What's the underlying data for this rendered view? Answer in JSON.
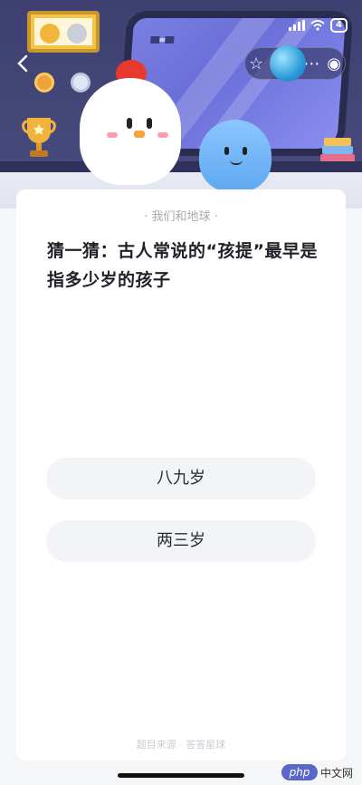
{
  "status_bar": {
    "battery": "4"
  },
  "header": {
    "back_icon": "chevron-left-icon",
    "actions": [
      "star-icon",
      "more-icon",
      "target-icon"
    ]
  },
  "card": {
    "title": "· 我们和地球 ·",
    "question": "猜一猜：古人常说的“孩提”最早是指多少岁的孩子",
    "options": [
      "八九岁",
      "两三岁"
    ],
    "source": "题目来源 · 答答星球"
  },
  "watermark": {
    "logo": "php",
    "text": "中文网"
  },
  "colors": {
    "accent": "#3c3f6a",
    "option_bg": "#f3f4f7",
    "comb": "#e8392e"
  }
}
